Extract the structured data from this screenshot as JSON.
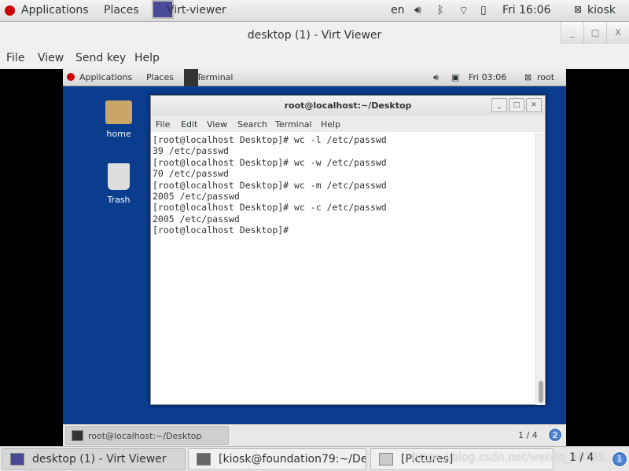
{
  "host_topbar": {
    "applications": "Applications",
    "places": "Places",
    "active_app": "Virt-viewer",
    "lang": "en",
    "clock": "Fri 16:06",
    "user": "kiosk"
  },
  "window": {
    "title": "desktop (1) - Virt Viewer",
    "minimize": "_",
    "maximize": "□",
    "close": "X"
  },
  "menu": [
    "File",
    "View",
    "Send key",
    "Help"
  ],
  "guest_topbar": {
    "applications": "Applications",
    "places": "Places",
    "active_app": "Terminal",
    "clock": "Fri 03:06",
    "user": "root"
  },
  "desktop_icons": [
    {
      "label": "home",
      "icon": "folder-home-icon"
    },
    {
      "label": "Trash",
      "icon": "trash-icon"
    }
  ],
  "terminal": {
    "title": "root@localhost:~/Desktop",
    "menu": [
      "File",
      "Edit",
      "View",
      "Search",
      "Terminal",
      "Help"
    ],
    "lines": [
      "[root@localhost Desktop]# wc -l /etc/passwd",
      "39 /etc/passwd",
      "[root@localhost Desktop]# wc -w /etc/passwd",
      "70 /etc/passwd",
      "[root@localhost Desktop]# wc -m /etc/passwd",
      "2005 /etc/passwd",
      "[root@localhost Desktop]# wc -c /etc/passwd",
      "2005 /etc/passwd",
      "[root@localhost Desktop]# "
    ]
  },
  "guest_taskbar": {
    "task": "root@localhost:~/Desktop",
    "workspace": "1 / 4",
    "badge": "2"
  },
  "host_taskbar": {
    "tasks": [
      "desktop (1) - Virt Viewer",
      "[kiosk@foundation79:~/Des...",
      "[Pictures]"
    ],
    "workspace": "1 / 4",
    "badge": "1"
  },
  "watermark": "https://blog.csdn.net/weixin_44135..."
}
